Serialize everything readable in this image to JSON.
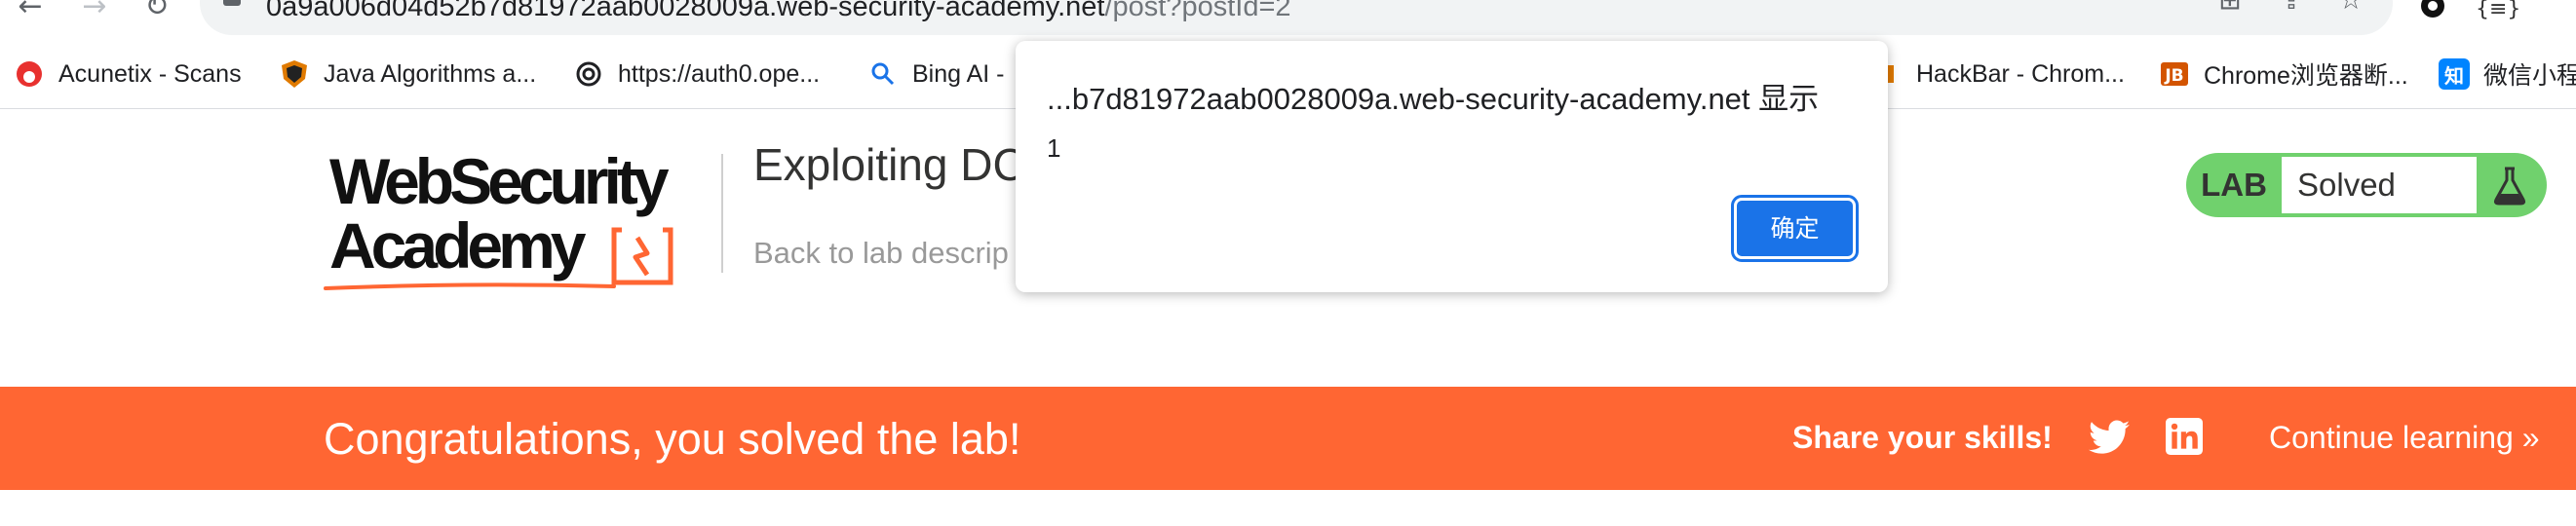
{
  "browser": {
    "url_host": "0a9a006d04d52b7d81972aab0028009a.web-security-academy.net",
    "url_path": "/post?postId=2",
    "nav_icons": [
      "back-arrow-icon",
      "forward-arrow-icon",
      "reload-icon"
    ],
    "omnibox_icons": [
      "lock-icon",
      "translate-icon",
      "share-icon",
      "star-icon"
    ],
    "extension_icons": [
      "extension-circle-icon",
      "json-extension-icon"
    ],
    "ext_json_glyph": "{≡}"
  },
  "bookmarks": [
    {
      "label": "Acunetix - Scans",
      "icon": "acunetix-icon",
      "color": "#e8312f"
    },
    {
      "label": "Java Algorithms a...",
      "icon": "shield-icon",
      "color": "#e07a00"
    },
    {
      "label": "https://auth0.ope...",
      "icon": "openai-icon",
      "color": "#202124"
    },
    {
      "label": "Bing AI -",
      "icon": "search-icon",
      "color": "#1a73e8"
    },
    {
      "label": "HackBar - Chrom...",
      "icon": "hackbar-icon",
      "color": "#e07a00"
    },
    {
      "label": "Chrome浏览器断...",
      "icon": "jb-icon",
      "color": "#d35400"
    },
    {
      "label": "微信小程",
      "icon": "zhihu-icon",
      "color": "#0084ff",
      "glyph": "知"
    }
  ],
  "header": {
    "logo_line1": "WebSecurity",
    "logo_line2": "Academy",
    "lab_title": "Exploiting DC",
    "back_link": "Back to lab descrip",
    "badge_label": "LAB",
    "badge_status": "Solved"
  },
  "dialog": {
    "title": "...b7d81972aab0028009a.web-security-academy.net 显示",
    "message": "1",
    "ok_label": "确定"
  },
  "banner": {
    "text": "Congratulations, you solved the lab!",
    "share_text": "Share your skills!",
    "continue_text": "Continue learning »"
  },
  "colors": {
    "brand_orange": "#ff6633",
    "lab_green": "#70d16d",
    "dialog_button": "#1a73e8"
  }
}
